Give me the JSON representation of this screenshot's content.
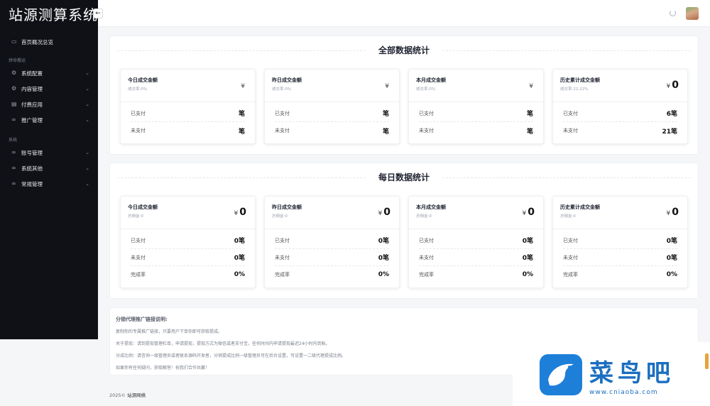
{
  "app": {
    "title": "站源测算系统",
    "collapse_icon": "←"
  },
  "sidebar": {
    "home": {
      "label": "首页概况总览",
      "icon": "monitor-icon"
    },
    "groups": [
      {
        "label": "拼命搬运",
        "items": [
          {
            "label": "系统配置",
            "icon": "gear-icon"
          },
          {
            "label": "内容管理",
            "icon": "gear-icon"
          },
          {
            "label": "付费应用",
            "icon": "grid-icon"
          },
          {
            "label": "推广管理",
            "icon": "link-icon"
          }
        ]
      },
      {
        "label": "系统",
        "items": [
          {
            "label": "账号管理",
            "icon": "link-icon"
          },
          {
            "label": "系统其他",
            "icon": "link-icon"
          },
          {
            "label": "常规管理",
            "icon": "link-icon"
          }
        ]
      }
    ]
  },
  "sections": [
    {
      "title": "全部数据统计",
      "cards": [
        {
          "title": "今日成交金额",
          "sub": "成交率:0%",
          "currency": "¥",
          "amount": "",
          "rows": [
            {
              "label": "已支付",
              "value": "笔"
            },
            {
              "label": "未支付",
              "value": "笔"
            }
          ]
        },
        {
          "title": "昨日成交金额",
          "sub": "成交率:0%",
          "currency": "¥",
          "amount": "",
          "rows": [
            {
              "label": "已支付",
              "value": "笔"
            },
            {
              "label": "未支付",
              "value": "笔"
            }
          ]
        },
        {
          "title": "本月成交金额",
          "sub": "成交率:0%",
          "currency": "¥",
          "amount": "",
          "rows": [
            {
              "label": "已支付",
              "value": "笔"
            },
            {
              "label": "未支付",
              "value": "笔"
            }
          ]
        },
        {
          "title": "历史累计成交金额",
          "sub": "成交率:22.22%",
          "currency": "¥",
          "amount": "0",
          "rows": [
            {
              "label": "已支付",
              "value": "6笔"
            },
            {
              "label": "未支付",
              "value": "21笔"
            }
          ]
        }
      ]
    },
    {
      "title": "每日数据统计",
      "cards": [
        {
          "title": "今日成交金额",
          "sub": "总佣金:0",
          "currency": "¥",
          "amount": "0",
          "rows": [
            {
              "label": "已支付",
              "value": "0笔"
            },
            {
              "label": "未支付",
              "value": "0笔"
            },
            {
              "label": "完成率",
              "value": "0%"
            }
          ]
        },
        {
          "title": "昨日成交金额",
          "sub": "总佣金:0",
          "currency": "¥",
          "amount": "0",
          "rows": [
            {
              "label": "已支付",
              "value": "0笔"
            },
            {
              "label": "未支付",
              "value": "0笔"
            },
            {
              "label": "完成率",
              "value": "0%"
            }
          ]
        },
        {
          "title": "本月成交金额",
          "sub": "总佣金:0",
          "currency": "¥",
          "amount": "0",
          "rows": [
            {
              "label": "已支付",
              "value": "0笔"
            },
            {
              "label": "未支付",
              "value": "0笔"
            },
            {
              "label": "完成率",
              "value": "0%"
            }
          ]
        },
        {
          "title": "历史累计成交金额",
          "sub": "总佣金:0",
          "currency": "¥",
          "amount": "0",
          "rows": [
            {
              "label": "已支付",
              "value": "0笔"
            },
            {
              "label": "未支付",
              "value": "0笔"
            },
            {
              "label": "完成率",
              "value": "0%"
            }
          ]
        }
      ]
    }
  ],
  "notes": {
    "title": "分销代理推广链接说明:",
    "lines": [
      "复制你的专属推广链接，只要用户下单你即可获取提成。",
      "关于提现：请到提现管理栏目，申请提现，提现方式为微信或者支付宝，任何时间内申请提现最迟24小时内到账。",
      "分成比例：请咨询一级管理员或者联系源码开发者，分销提成比例一级管理员可在后台设置，可设置一二级代理提成比例。",
      "如果你有任何疑问，获取解答！祝我们合作共赢！"
    ]
  },
  "footer": {
    "year": "2025©",
    "brand": "站源网络"
  },
  "watermark": {
    "text": "菜鸟吧",
    "url": "www.cniaoba.com"
  }
}
